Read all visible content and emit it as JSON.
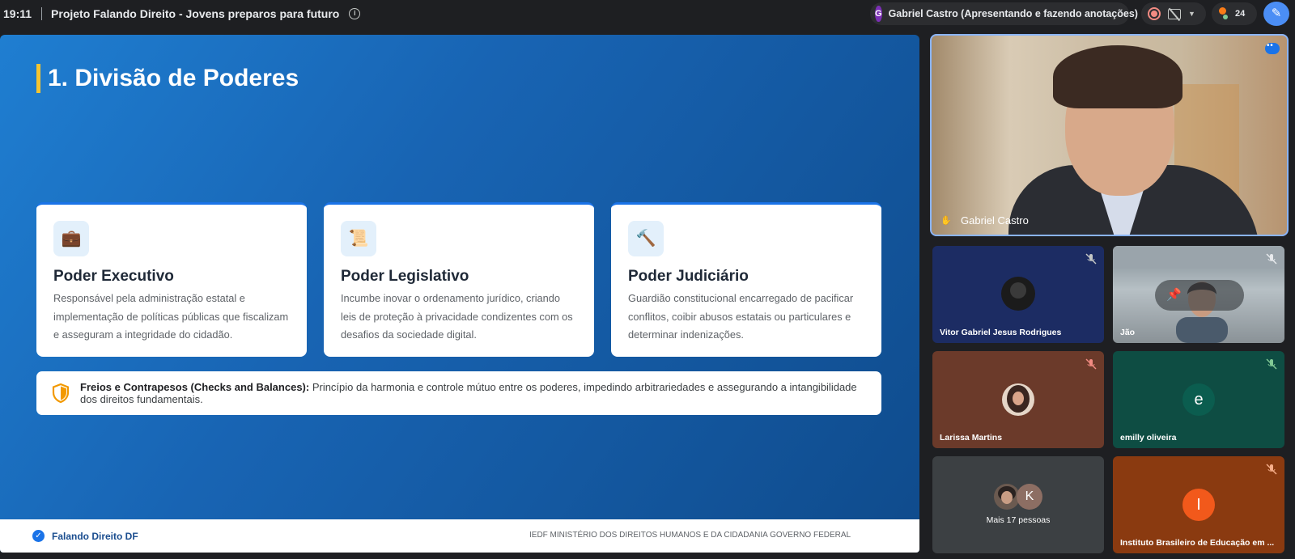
{
  "topbar": {
    "time": "19:11",
    "title": "Projeto Falando Direito - Jovens preparos para futuro",
    "info_icon": "i",
    "presenter_initial": "G",
    "presenter_text": "Gabriel Castro (Apresentando e fazendo anotações)",
    "participant_count": "24",
    "pen_icon": "✎"
  },
  "slide": {
    "title": "1. Divisão de Poderes",
    "cards": [
      {
        "icon": "💼",
        "title": "Poder Executivo",
        "text": "Responsável pela administração estatal e implementação de políticas públicas que fiscalizam e asseguram a integridade do cidadão."
      },
      {
        "icon": "📜",
        "title": "Poder Legislativo",
        "text": "Incumbe inovar o ordenamento jurídico, criando leis de proteção à privacidade condizentes com os desafios da sociedade digital."
      },
      {
        "icon": "🔨",
        "title": "Poder Judiciário",
        "text": "Guardião constitucional encarregado de pacificar conflitos, coibir abusos estatais ou particulares e determinar indenizações."
      }
    ],
    "checks_title": "Freios e Contrapesos (Checks and Balances):",
    "checks_text": " Princípio da harmonia e controle mútuo entre os poderes, impedindo arbitrariedades e assegurando a intangibilidade dos direitos fundamentais.",
    "footer_check": "✓",
    "footer_brand": "Falando Direito DF",
    "footer_right": "IEDF MINISTÉRIO DOS DIREITOS HUMANOS E DA CIDADANIA GOVERNO FEDERAL"
  },
  "participants": {
    "main": {
      "name": "Gabriel Castro",
      "pin_icon": "✋"
    },
    "tiles": [
      {
        "name": "Vitor Gabriel Jesus Rodrigues"
      },
      {
        "name": "Jão",
        "pin_icon": "📌"
      },
      {
        "name": "Larissa Martins"
      },
      {
        "name": "emilly oliveira",
        "initial": "e"
      },
      {
        "name": "Mais 17 pessoas",
        "initial": "K"
      },
      {
        "name": "Instituto Brasileiro de Educação em ...",
        "initial": "I"
      }
    ]
  },
  "colors": {
    "slide_blue": "#1864b3",
    "accent_yellow": "#f4c430",
    "shield_orange": "#f29900",
    "inst_avatar": "#f2591b",
    "emilly_avatar": "#0b5d4f"
  }
}
